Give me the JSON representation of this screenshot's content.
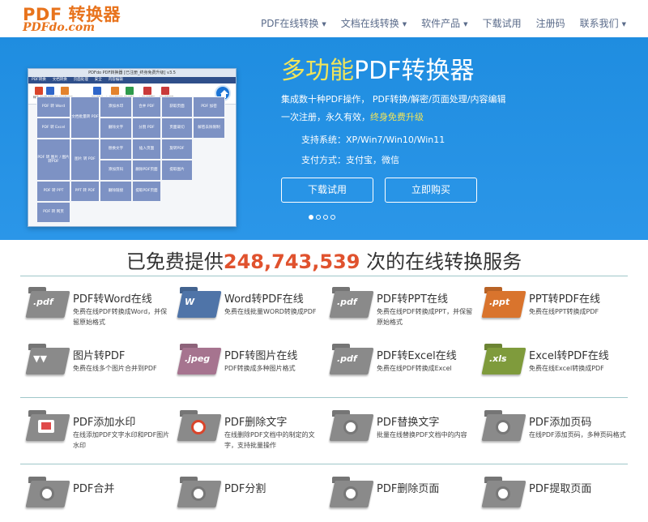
{
  "header": {
    "logo_main": "PDF 转换器",
    "logo_sub": "PDFdo.com",
    "nav": [
      {
        "label": "PDF在线转换",
        "dropdown": true
      },
      {
        "label": "文档在线转换",
        "dropdown": true
      },
      {
        "label": "软件产品",
        "dropdown": true
      },
      {
        "label": "下载试用",
        "dropdown": false
      },
      {
        "label": "注册码",
        "dropdown": false
      },
      {
        "label": "联系我们",
        "dropdown": true
      }
    ]
  },
  "banner": {
    "title_highlight": "多功能",
    "title_rest": "PDF转换器",
    "line1": "集成数十种PDF操作， PDF转换/解密/页面处理/内容编辑",
    "line2_prefix": "一次注册，永久有效，",
    "line2_highlight": "终身免费升级",
    "system": "支持系统：XP/Win7/Win10/Win11",
    "payment": "支付方式：支付宝，微信",
    "btn_download": "下载试用",
    "btn_buy": "立即购买",
    "slides": 4,
    "active_slide": 1,
    "window": {
      "title": "PDFdo PDF转换器 [已注册_终身免费升级] v3.5",
      "menu": [
        "PDF转换",
        "文档转换",
        "页面处理",
        "安全",
        "内容编辑"
      ],
      "toolbar": [
        {
          "label": "转换 PDF",
          "color": "#d9452b"
        },
        {
          "label": "多页拼PDF",
          "color": "#2f66c9"
        },
        {
          "label": "PPT转PDF",
          "color": "#e3822c"
        },
        {
          "label": "PDF转Word",
          "color": "#2f66c9"
        },
        {
          "label": "PDF转PPT",
          "color": "#e3822c"
        },
        {
          "label": "PDF转Excel",
          "color": "#2e9a4b"
        },
        {
          "label": "PDF转图片",
          "color": "#c93a3a"
        },
        {
          "label": "PDF转网页",
          "color": "#c93a3a"
        }
      ],
      "tiles": [
        "PDF 转 Word",
        "文档批量转 PDF",
        "添加水印",
        "合并 PDF",
        "获取页面",
        "PDF 加密",
        "PDF 转 Excel",
        "删除文字",
        "分割 PDF",
        "页面裁切",
        "解密去除限制",
        "PDF 转 图片 / 图片转PDF",
        "图片 转 PDF",
        "替换文字",
        "插入页面",
        "旋转PDF",
        "PDF 转 PPT",
        "PPT 转 PDF",
        "添加页码",
        "删除PDF页面",
        "提取图片",
        "PDF 转 网页",
        "删除链接",
        "提取PDF页面"
      ]
    }
  },
  "counter": {
    "prefix": "已免费提供",
    "number": "248,743,539",
    "suffix": " 次的在线转换服务"
  },
  "services": [
    {
      "title": "PDF转Word在线",
      "desc": "免费在线PDF转换成Word，并保留原始格式",
      "icon": "pdf-folder-icon",
      "tag": ".pdf",
      "color": "#8a8a8a"
    },
    {
      "title": "Word转PDF在线",
      "desc": "免费在线批量WORD转换成PDF",
      "icon": "word-folder-icon",
      "tag": "W",
      "color": "#4f74a8"
    },
    {
      "title": "PDF转PPT在线",
      "desc": "免费在线PDF转换成PPT，并保留原始格式",
      "icon": "pdf-folder-icon",
      "tag": ".pdf",
      "color": "#8a8a8a"
    },
    {
      "title": "PPT转PDF在线",
      "desc": "免费在线PPT转换成PDF",
      "icon": "ppt-folder-icon",
      "tag": ".ppt",
      "color": "#d9742d"
    },
    {
      "title": "图片转PDF",
      "desc": "免费在线多个图片合并到PDF",
      "icon": "image-folder-icon",
      "tag": "▼▼",
      "color": "#8a8a8a"
    },
    {
      "title": "PDF转图片在线",
      "desc": "PDF转换成多种图片格式",
      "icon": "jpeg-folder-icon",
      "tag": ".jpeg",
      "color": "#a6748f"
    },
    {
      "title": "PDF转Excel在线",
      "desc": "免费在线PDF转换成Excel",
      "icon": "pdf-folder-icon",
      "tag": ".pdf",
      "color": "#8a8a8a"
    },
    {
      "title": "Excel转PDF在线",
      "desc": "免费在线Excel转换成PDF",
      "icon": "xls-folder-icon",
      "tag": ".xls",
      "color": "#7f9b3c"
    },
    {
      "title": "PDF添加水印",
      "desc": "在线添加PDF文字水印和PDF图片水印",
      "icon": "watermark-folder-icon",
      "tag": "",
      "color": "#8a8a8a"
    },
    {
      "title": "PDF删除文字",
      "desc": "在线删除PDF文档中的制定的文字，支持批量操作",
      "icon": "delete-text-folder-icon",
      "tag": "",
      "color": "#8a8a8a"
    },
    {
      "title": "PDF替换文字",
      "desc": "批量在线替换PDF文档中的内容",
      "icon": "replace-text-folder-icon",
      "tag": "",
      "color": "#8a8a8a"
    },
    {
      "title": "PDF添加页码",
      "desc": "在线PDF添加页码，多种页码格式",
      "icon": "page-number-folder-icon",
      "tag": "",
      "color": "#8a8a8a"
    },
    {
      "title": "PDF合并",
      "desc": "",
      "icon": "merge-folder-icon",
      "tag": "",
      "color": "#8a8a8a"
    },
    {
      "title": "PDF分割",
      "desc": "",
      "icon": "split-folder-icon",
      "tag": "",
      "color": "#8a8a8a"
    },
    {
      "title": "PDF删除页面",
      "desc": "",
      "icon": "delete-page-folder-icon",
      "tag": "",
      "color": "#8a8a8a"
    },
    {
      "title": "PDF提取页面",
      "desc": "",
      "icon": "extract-page-folder-icon",
      "tag": "",
      "color": "#8a8a8a"
    }
  ]
}
